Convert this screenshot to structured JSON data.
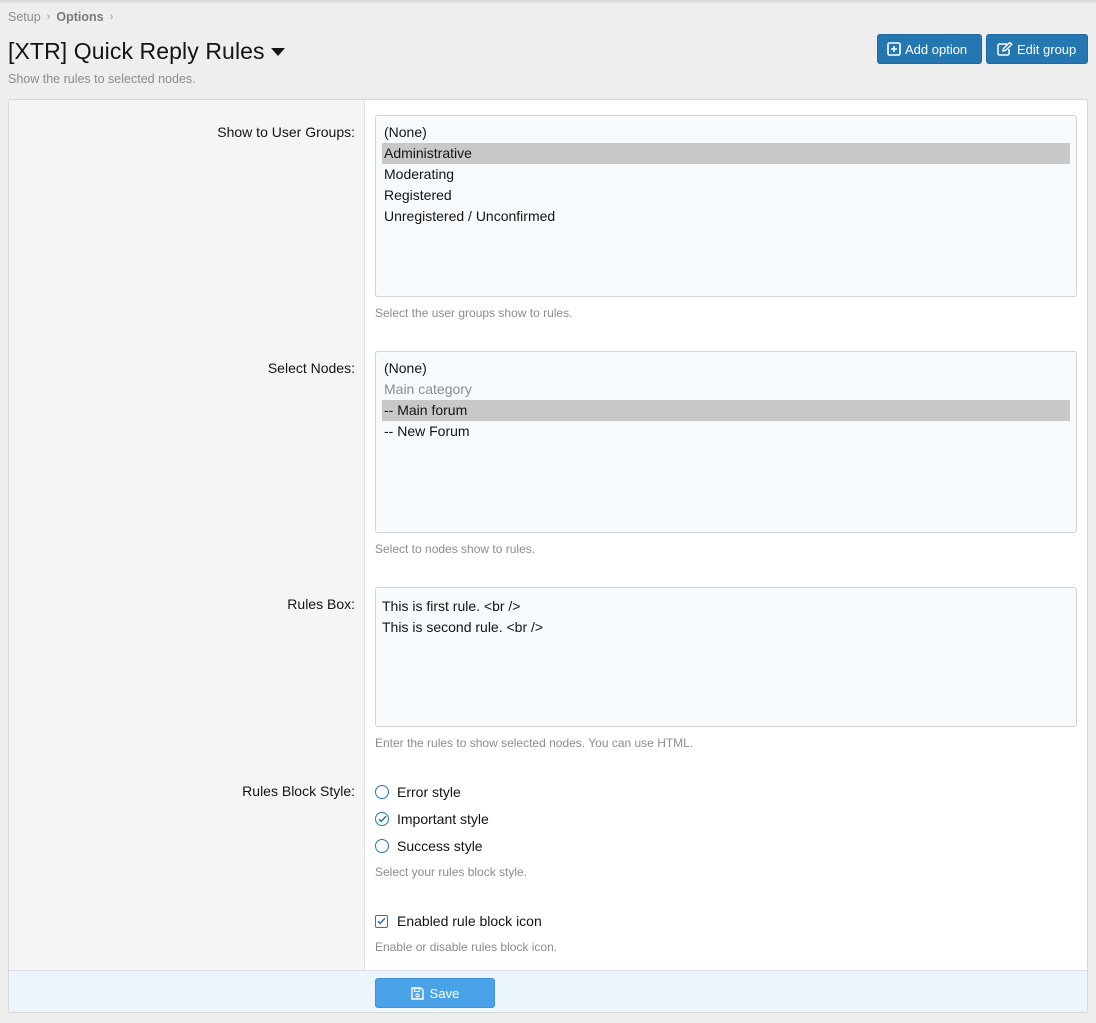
{
  "breadcrumb": {
    "items": [
      {
        "label": "Setup"
      },
      {
        "label": "Options"
      }
    ],
    "separator": "›"
  },
  "header": {
    "title": "[XTR] Quick Reply Rules",
    "description": "Show the rules to selected nodes.",
    "add_option_label": "Add option",
    "edit_group_label": "Edit group"
  },
  "form": {
    "user_groups": {
      "label": "Show to User Groups:",
      "options": [
        {
          "label": "(None)",
          "selected": false
        },
        {
          "label": "Administrative",
          "selected": true
        },
        {
          "label": "Moderating",
          "selected": false
        },
        {
          "label": "Registered",
          "selected": false
        },
        {
          "label": "Unregistered / Unconfirmed",
          "selected": false
        }
      ],
      "hint": "Select the user groups show to rules."
    },
    "nodes": {
      "label": "Select Nodes:",
      "options": [
        {
          "label": "(None)",
          "selected": false,
          "disabled": false
        },
        {
          "label": "Main category",
          "selected": false,
          "disabled": true
        },
        {
          "label": "-- Main forum",
          "selected": true,
          "disabled": false
        },
        {
          "label": "-- New Forum",
          "selected": false,
          "disabled": false
        }
      ],
      "hint": "Select to nodes show to rules."
    },
    "rules_box": {
      "label": "Rules Box:",
      "lines": [
        "This is first rule. <br />",
        "This is second rule. <br />"
      ],
      "hint": "Enter the rules to show selected nodes. You can use HTML."
    },
    "block_style": {
      "label": "Rules Block Style:",
      "options": [
        {
          "label": "Error style",
          "checked": false
        },
        {
          "label": "Important style",
          "checked": true
        },
        {
          "label": "Success style",
          "checked": false
        }
      ],
      "hint": "Select your rules block style."
    },
    "block_icon": {
      "label": "Enabled rule block icon",
      "checked": true,
      "hint": "Enable or disable rules block icon."
    },
    "save_label": "Save"
  },
  "colors": {
    "primary": "#2577b1",
    "save": "#4aa3e8",
    "selected_option": "#c8c8c8"
  }
}
